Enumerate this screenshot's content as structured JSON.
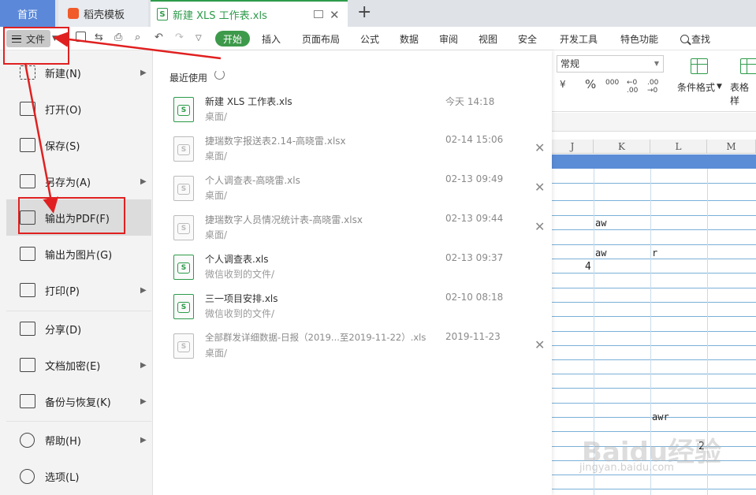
{
  "tabs": [
    {
      "label": "首页"
    },
    {
      "label": "稻壳模板"
    },
    {
      "label": "新建 XLS 工作表.xls"
    }
  ],
  "ribbon": {
    "file_label": "文件",
    "start_label": "开始",
    "menus": [
      "插入",
      "页面布局",
      "公式",
      "数据",
      "审阅",
      "视图",
      "安全",
      "开发工具",
      "特色功能"
    ],
    "search_label": "查找",
    "number_format": "常规",
    "number_format_buttons": [
      "¥",
      "%",
      "000",
      "←0 .00",
      ".00 →0"
    ],
    "cond_format_label": "条件格式",
    "table_format_label": "表格样"
  },
  "file_menu": {
    "items": [
      {
        "label": "新建(N)",
        "icon": "new-icon",
        "arrow": true
      },
      {
        "label": "打开(O)",
        "icon": "open-folder-icon",
        "arrow": false
      },
      {
        "label": "保存(S)",
        "icon": "save-icon",
        "arrow": false
      },
      {
        "label": "另存为(A)",
        "icon": "save-as-icon",
        "arrow": true
      },
      {
        "label": "输出为PDF(F)",
        "icon": "export-pdf-icon",
        "arrow": false,
        "active": true
      },
      {
        "label": "输出为图片(G)",
        "icon": "export-image-icon",
        "arrow": false
      },
      {
        "label": "打印(P)",
        "icon": "print-icon",
        "arrow": true
      },
      {
        "label": "分享(D)",
        "icon": "share-icon",
        "arrow": false
      },
      {
        "label": "文档加密(E)",
        "icon": "encrypt-icon",
        "arrow": true
      },
      {
        "label": "备份与恢复(K)",
        "icon": "backup-icon",
        "arrow": true
      },
      {
        "label": "帮助(H)",
        "icon": "help-icon",
        "arrow": true
      },
      {
        "label": "选项(L)",
        "icon": "options-gear-icon",
        "arrow": false
      }
    ]
  },
  "recent": {
    "title": "最近使用",
    "files": [
      {
        "name": "新建 XLS 工作表.xls",
        "path": "桌面/",
        "date": "今天 14:18",
        "available": true,
        "closable": false
      },
      {
        "name": "捷瑞数字报送表2.14-高晓雷.xlsx",
        "path": "桌面/",
        "date": "02-14 15:06",
        "available": false,
        "closable": true
      },
      {
        "name": "个人调查表-高晓雷.xls",
        "path": "桌面/",
        "date": "02-13 09:49",
        "available": false,
        "closable": true
      },
      {
        "name": "捷瑞数字人员情况统计表-高晓雷.xlsx",
        "path": "桌面/",
        "date": "02-13 09:44",
        "available": false,
        "closable": true
      },
      {
        "name": "个人调查表.xls",
        "path": "微信收到的文件/",
        "date": "02-13 09:37",
        "available": true,
        "closable": false
      },
      {
        "name": "三一项目安排.xls",
        "path": "微信收到的文件/",
        "date": "02-10 08:18",
        "available": true,
        "closable": false
      },
      {
        "name": "全部群发详细数据-日报（2019...至2019-11-22）.xls",
        "path": "桌面/",
        "date": "2019-11-23",
        "available": false,
        "closable": true
      }
    ]
  },
  "sheet": {
    "columns": [
      "J",
      "K",
      "L",
      "M"
    ],
    "cells": [
      "aw",
      "aw",
      "r",
      "4",
      "awr",
      "2"
    ]
  },
  "watermark": {
    "main": "Baidu经验",
    "sub": "jingyan.baidu.com"
  },
  "colors": {
    "accent_green": "#3d9a4a",
    "home_tab": "#5b88d9",
    "annotation_red": "#e02020",
    "header_blue_row": "#5b8dd6"
  }
}
